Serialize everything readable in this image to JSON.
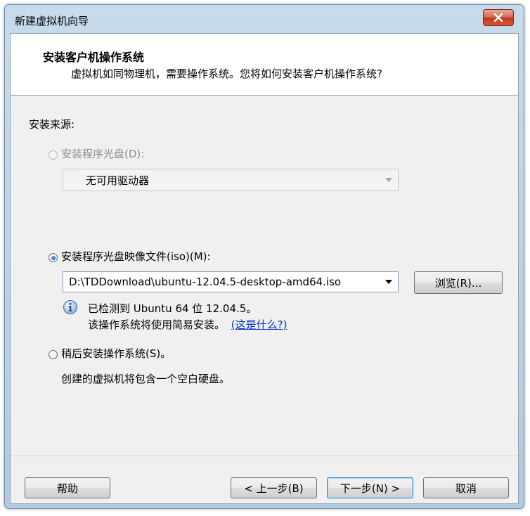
{
  "window": {
    "title": "新建虚拟机向导"
  },
  "header": {
    "title": "安装客户机操作系统",
    "subtitle": "虚拟机如同物理机，需要操作系统。您将如何安装客户机操作系统?"
  },
  "install_source": {
    "label": "安装来源:",
    "disc": {
      "label": "安装程序光盘(D):",
      "selected": false,
      "enabled": false,
      "drive_value": "无可用驱动器"
    },
    "iso": {
      "label": "安装程序光盘映像文件(iso)(M):",
      "selected": true,
      "path": "D:\\TDDownload\\ubuntu-12.04.5-desktop-amd64.iso",
      "browse_label": "浏览(R)...",
      "detected_line1": "已检测到 Ubuntu 64 位 12.04.5。",
      "detected_line2": "该操作系统将使用简易安装。",
      "whats_this_link": "(这是什么?)"
    },
    "later": {
      "label": "稍后安装操作系统(S)。",
      "selected": false,
      "description": "创建的虚拟机将包含一个空白硬盘。"
    }
  },
  "footer": {
    "help_label": "帮助",
    "back_label": "< 上一步(B)",
    "next_label": "下一步(N) >",
    "cancel_label": "取消"
  },
  "icons": {
    "close": "close-icon",
    "info": "info-icon",
    "dropdown": "chevron-down-icon"
  }
}
